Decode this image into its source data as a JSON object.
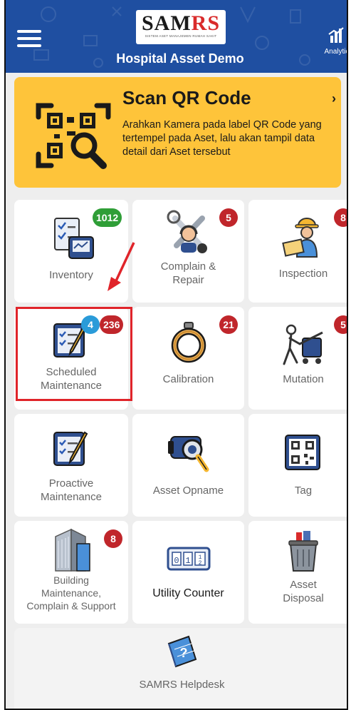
{
  "header": {
    "logo_text_main": "SAM",
    "logo_text_accent": "RS",
    "logo_subtext": "SISTEM ASET MANAJEMEN RUMAH SAKIT",
    "title": "Hospital Asset Demo",
    "analytic_label": "Analytic",
    "menu_icon": "hamburger-icon",
    "analytic_icon": "bar-chart-icon"
  },
  "scan": {
    "title": "Scan QR Code",
    "description": "Arahkan Kamera pada label QR Code yang tertempel pada Aset, lalu akan tampil data detail dari Aset tersebut",
    "chevron": "›",
    "icon": "qr-scan-icon",
    "color": "#fec43a"
  },
  "tiles": {
    "inventory": {
      "label": "Inventory",
      "badge": "1012",
      "icon": "inventory-checklist-icon"
    },
    "complain_repair": {
      "label": "Complain &\nRepair",
      "badge": "5",
      "icon": "wrench-tools-icon"
    },
    "inspection": {
      "label": "Inspection",
      "badge": "8",
      "icon": "inspector-icon"
    },
    "scheduled_maintenance": {
      "label": "Scheduled\nMaintenance",
      "badge": "236",
      "badge_secondary": "4",
      "icon": "clipboard-pen-icon"
    },
    "calibration": {
      "label": "Calibration",
      "badge": "21",
      "icon": "calibration-ring-icon"
    },
    "mutation": {
      "label": "Mutation",
      "badge": "5",
      "icon": "moving-cart-icon"
    },
    "proactive_maintenance": {
      "label": "Proactive\nMaintenance",
      "icon": "clipboard-pen-icon"
    },
    "asset_opname": {
      "label": "Asset Opname",
      "icon": "camera-magnifier-icon"
    },
    "tag": {
      "label": "Tag",
      "icon": "qr-tag-icon"
    },
    "building_maintenance": {
      "label": "Building\nMaintenance,\nComplain & Support",
      "badge": "8",
      "icon": "building-icon"
    },
    "utility_counter": {
      "label": "Utility Counter",
      "icon": "counter-meter-icon"
    },
    "asset_disposal": {
      "label": "Asset\nDisposal",
      "icon": "trash-bin-icon"
    },
    "helpdesk": {
      "label": "SAMRS Helpdesk",
      "icon": "help-book-icon"
    }
  },
  "colors": {
    "header_bg": "#1f4fa1",
    "badge_red": "#c0262b",
    "badge_green": "#2f9e37",
    "badge_blue": "#2a9bd9",
    "highlight": "#e0242a"
  }
}
